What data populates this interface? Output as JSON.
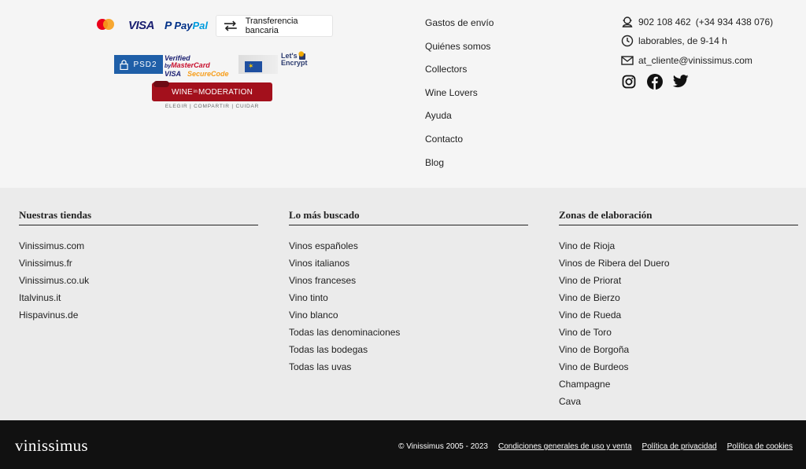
{
  "payments": {
    "visa_label": "VISA",
    "paypal_pay": "Pay",
    "paypal_pal": "Pal",
    "transfer_label": "Transferencia bancaria"
  },
  "badges": {
    "psd2": "PSD2",
    "vbv_line1_a": "Verified",
    "vbv_line1_b": "by",
    "vbv_line1_c": "MasterCard",
    "vbv_line2_a": "VISA",
    "vbv_line2_b": "SecureCode",
    "letsencrypt_l1": "Let's",
    "letsencrypt_l2": "Encrypt",
    "wim_a": "WINE",
    "wim_in": "in",
    "wim_b": "MODERATION",
    "wim_sub": "ELEGIR | COMPARTIR | CUIDAR"
  },
  "info_links": [
    "Gastos de envío",
    "Quiénes somos",
    "Collectors",
    "Wine Lovers",
    "Ayuda",
    "Contacto",
    "Blog"
  ],
  "contact": {
    "phone": "902 108 462",
    "phone_alt": "(+34 934 438 076)",
    "hours": "laborables, de 9-14 h",
    "email": "at_cliente@vinissimus.com"
  },
  "columns": {
    "stores": {
      "title": "Nuestras tiendas",
      "items": [
        "Vinissimus.com",
        "Vinissimus.fr",
        "Vinissimus.co.uk",
        "Italvinus.it",
        "Hispavinus.de"
      ]
    },
    "searched": {
      "title": "Lo más buscado",
      "items": [
        "Vinos españoles",
        "Vinos italianos",
        "Vinos franceses",
        "Vino tinto",
        "Vino blanco",
        "Todas las denominaciones",
        "Todas las bodegas",
        "Todas las uvas"
      ]
    },
    "zones": {
      "title": "Zonas de elaboración",
      "items": [
        "Vino de Rioja",
        "Vinos de Ribera del Duero",
        "Vino de Priorat",
        "Vino de Bierzo",
        "Vino de Rueda",
        "Vino de Toro",
        "Vino de Borgoña",
        "Vino de Burdeos",
        "Champagne",
        "Cava"
      ]
    }
  },
  "footer": {
    "brand": "vinissimus",
    "copyright": "© Vinissimus 2005 - 2023",
    "terms": "Condiciones generales de uso y venta",
    "privacy": "Política de privacidad",
    "cookies": "Política de cookies"
  }
}
